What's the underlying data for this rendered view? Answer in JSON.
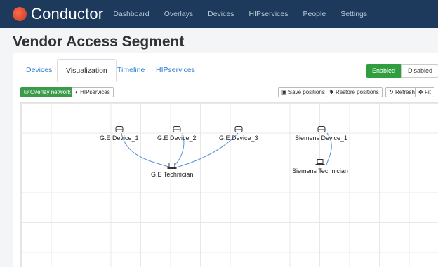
{
  "app": {
    "name": "Conductor"
  },
  "nav": [
    "Dashboard",
    "Overlays",
    "Devices",
    "HIPservices",
    "People",
    "Settings"
  ],
  "page": {
    "title": "Vendor Access Segment"
  },
  "tabs": [
    "Devices",
    "Visualization",
    "Timeline",
    "HIPservices"
  ],
  "active_tab": "Visualization",
  "status_toggle": {
    "enabled": "Enabled",
    "disabled": "Disabled"
  },
  "view_buttons": {
    "overlay_network": "Overlay network",
    "hipservices": "HIPservices"
  },
  "toolbar": {
    "save": "Save positions",
    "restore": "Restore positions",
    "refresh": "Refresh",
    "fit": "Fit"
  },
  "nodes": {
    "ge_device_1": "G.E Device_1",
    "ge_device_2": "G.E Device_2",
    "ge_device_3": "G.E Device_3",
    "siemens_device_1": "Siemens Device_1",
    "ge_technician": "G.E Technician",
    "siemens_technician": "Siemens Technician"
  },
  "colors": {
    "nav_bg": "#1d3a5c",
    "accent_green": "#2e9e3e",
    "link_blue": "#2d7dd2",
    "edge_blue": "#5b8fd6"
  }
}
